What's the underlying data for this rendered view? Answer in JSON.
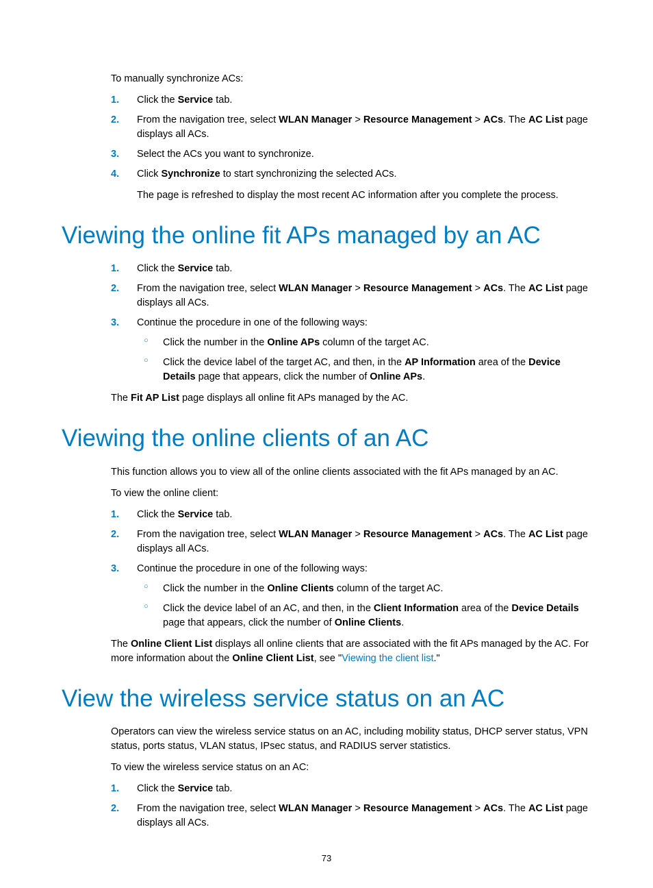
{
  "page_number": "73",
  "section1": {
    "intro": "To manually synchronize ACs:",
    "steps": {
      "s1": {
        "num": "1.",
        "pre": "Click the ",
        "b1": "Service",
        "post": " tab."
      },
      "s2": {
        "num": "2.",
        "pre": "From the navigation tree, select ",
        "b1": "WLAN Manager",
        "sep1": " > ",
        "b2": "Resource Management",
        "sep2": " > ",
        "b3": "ACs",
        "mid": ". The ",
        "b4": "AC List",
        "post": " page displays all ACs."
      },
      "s3": {
        "num": "3.",
        "text": "Select the ACs you want to synchronize."
      },
      "s4": {
        "num": "4.",
        "pre": "Click ",
        "b1": "Synchronize",
        "post": " to start synchronizing the selected ACs.",
        "note": "The page is refreshed to display the most recent AC information after you complete the process."
      }
    }
  },
  "section2": {
    "heading": "Viewing the online fit APs managed by an AC",
    "steps": {
      "s1": {
        "num": "1.",
        "pre": "Click the ",
        "b1": "Service",
        "post": " tab."
      },
      "s2": {
        "num": "2.",
        "pre": "From the navigation tree, select ",
        "b1": "WLAN Manager",
        "sep1": " > ",
        "b2": "Resource Management",
        "sep2": " > ",
        "b3": "ACs",
        "mid": ". The ",
        "b4": "AC List",
        "post": " page displays all ACs."
      },
      "s3": {
        "num": "3.",
        "text": "Continue the procedure in one of the following ways:",
        "bullets": {
          "b1": {
            "pre": "Click the number in the ",
            "bold1": "Online APs",
            "post": " column of the target AC."
          },
          "b2": {
            "pre": "Click the device label of the target AC, and then, in the ",
            "bold1": "AP Information",
            "mid1": " area of the ",
            "bold2": "Device Details",
            "mid2": " page that appears, click the number of ",
            "bold3": "Online APs",
            "post": "."
          }
        }
      }
    },
    "closing": {
      "pre": "The ",
      "b1": "Fit AP List",
      "post": " page displays all online fit APs managed by the AC."
    }
  },
  "section3": {
    "heading": "Viewing the online clients of an AC",
    "intro": "This function allows you to view all of the online clients associated with the fit APs managed by an AC.",
    "intro2": "To view the online client:",
    "steps": {
      "s1": {
        "num": "1.",
        "pre": "Click the ",
        "b1": "Service",
        "post": " tab."
      },
      "s2": {
        "num": "2.",
        "pre": "From the navigation tree, select ",
        "b1": "WLAN Manager",
        "sep1": " > ",
        "b2": "Resource Management",
        "sep2": " > ",
        "b3": "ACs",
        "mid": ". The ",
        "b4": "AC List",
        "post": " page displays all ACs."
      },
      "s3": {
        "num": "3.",
        "text": "Continue the procedure in one of the following ways:",
        "bullets": {
          "b1": {
            "pre": "Click the number in the ",
            "bold1": "Online Clients",
            "post": " column of the target AC."
          },
          "b2": {
            "pre": "Click the device label of an AC, and then, in the ",
            "bold1": "Client Information",
            "mid1": " area of the ",
            "bold2": "Device Details",
            "mid2": " page that appears, click the number of ",
            "bold3": "Online Clients",
            "post": "."
          }
        }
      }
    },
    "closing": {
      "pre": "The ",
      "b1": "Online Client List",
      "mid": " displays all online clients that are associated with the fit APs managed by the AC. For more information about the ",
      "b2": "Online Client List",
      "mid2": ", see \"",
      "link": "Viewing the client list",
      "post": ".\""
    }
  },
  "section4": {
    "heading": "View the wireless service status on an AC",
    "intro": "Operators can view the wireless service status on an AC, including mobility status, DHCP server status, VPN status, ports status, VLAN status, IPsec status, and RADIUS server statistics.",
    "intro2": "To view the wireless service status on an AC:",
    "steps": {
      "s1": {
        "num": "1.",
        "pre": "Click the ",
        "b1": "Service",
        "post": " tab."
      },
      "s2": {
        "num": "2.",
        "pre": "From the navigation tree, select ",
        "b1": "WLAN Manager",
        "sep1": " > ",
        "b2": "Resource Management",
        "sep2": " > ",
        "b3": "ACs",
        "mid": ". The ",
        "b4": "AC List",
        "post": " page displays all ACs."
      }
    }
  }
}
